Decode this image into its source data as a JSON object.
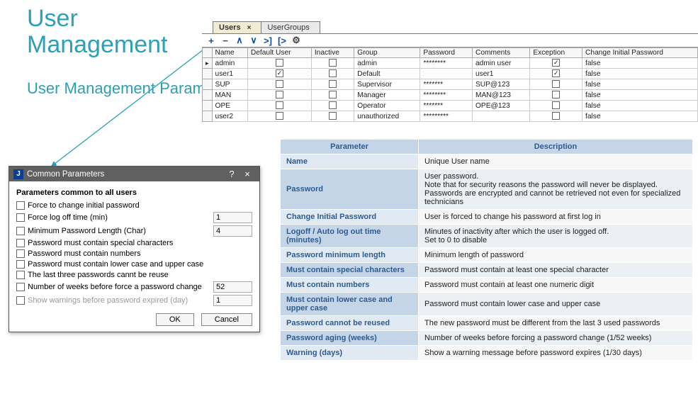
{
  "titles": {
    "main": "User\nManagement",
    "sub": "User Management Parameters"
  },
  "tabs": {
    "active": "Users",
    "inactive": "UserGroups"
  },
  "toolbar_icons": [
    "plus",
    "minus",
    "up",
    "down",
    "first",
    "last",
    "gear"
  ],
  "grid": {
    "columns": [
      "Name",
      "Default User",
      "Inactive",
      "Group",
      "Password",
      "Comments",
      "Exception",
      "Change Initial Password"
    ],
    "rows": [
      {
        "ptr": "▸",
        "name": "admin",
        "default": false,
        "inactive": false,
        "group": "admin",
        "password": "********",
        "comments": "admin user",
        "exception": true,
        "cip": "false"
      },
      {
        "ptr": "",
        "name": "user1",
        "default": true,
        "inactive": false,
        "group": "Default",
        "password": "",
        "comments": "user1",
        "exception": true,
        "cip": "false"
      },
      {
        "ptr": "",
        "name": "SUP",
        "default": false,
        "inactive": false,
        "group": "Supervisor",
        "password": "*******",
        "comments": "SUP@123",
        "exception": false,
        "cip": "false"
      },
      {
        "ptr": "",
        "name": "MAN",
        "default": false,
        "inactive": false,
        "group": "Manager",
        "password": "********",
        "comments": "MAN@123",
        "exception": false,
        "cip": "false"
      },
      {
        "ptr": "",
        "name": "OPE",
        "default": false,
        "inactive": false,
        "group": "Operator",
        "password": "*******",
        "comments": "OPE@123",
        "exception": false,
        "cip": "false"
      },
      {
        "ptr": "",
        "name": "user2",
        "default": false,
        "inactive": false,
        "group": "unauthorized",
        "password": "*********",
        "comments": "",
        "exception": false,
        "cip": "false"
      }
    ]
  },
  "dialog": {
    "title": "Common Parameters",
    "section_title": "Parameters common to all users",
    "rows": [
      {
        "label": "Force to change initial password",
        "value": null,
        "enabled": true
      },
      {
        "label": "Force log off time (min)",
        "value": "1",
        "enabled": true
      },
      {
        "label": "Minimum Password Length (Char)",
        "value": "4",
        "enabled": true
      },
      {
        "label": "Password must contain special characters",
        "value": null,
        "enabled": true
      },
      {
        "label": "Password must contain numbers",
        "value": null,
        "enabled": true
      },
      {
        "label": "Password must contain lower case and upper case",
        "value": null,
        "enabled": true
      },
      {
        "label": "The last three passwords cannt be reuse",
        "value": null,
        "enabled": true
      },
      {
        "label": "Number of weeks before force a password change",
        "value": "52",
        "enabled": true
      },
      {
        "label": "Show warnings before password expired (day)",
        "value": "1",
        "enabled": false
      }
    ],
    "ok": "OK",
    "cancel": "Cancel"
  },
  "desc": {
    "hdr_param": "Parameter",
    "hdr_desc": "Description",
    "rows": [
      {
        "p": "Name",
        "d": "Unique User name"
      },
      {
        "p": "Password",
        "d": "User password.\nNote that for security reasons the password will never be displayed. Passwords are encrypted and cannot be retrieved not even for specialized technicians"
      },
      {
        "p": "Change Initial Password",
        "d": "User is forced to change his password at first log in"
      },
      {
        "p": "Logoff / Auto log out  time (minutes)",
        "d": "Minutes of inactivity after which the user is logged off.\nSet to 0 to disable"
      },
      {
        "p": "Password minimum length",
        "d": "Minimum length of password"
      },
      {
        "p": "Must contain special characters",
        "d": "Password must contain at least one special character"
      },
      {
        "p": "Must contain numbers",
        "d": "Password must contain at least one numeric digit"
      },
      {
        "p": "Must contain lower case and upper case",
        "d": "Password must contain lower case and upper case"
      },
      {
        "p": "Password cannot be reused",
        "d": "The new password must be different from the last 3 used passwords"
      },
      {
        "p": "Password aging (weeks)",
        "d": "Number of weeks before forcing a password change (1/52 weeks)"
      },
      {
        "p": "Warning (days)",
        "d": "Show a warning message before password expires (1/30 days)"
      }
    ]
  }
}
